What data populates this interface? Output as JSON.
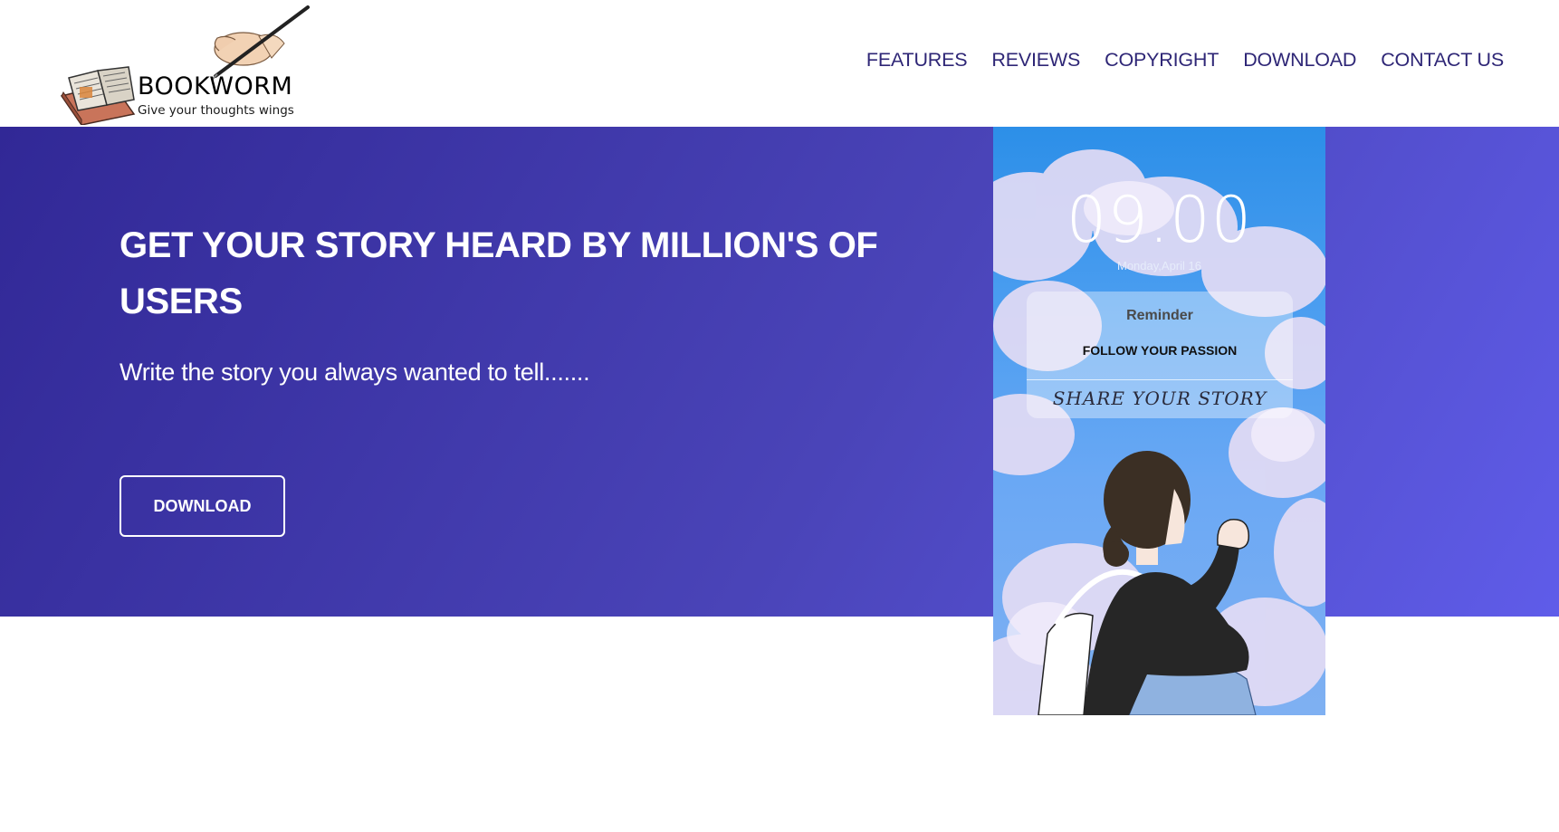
{
  "brand": {
    "name": "BOOKWORM",
    "tagline": "Give your thoughts wings"
  },
  "nav": {
    "items": [
      {
        "label": "FEATURES"
      },
      {
        "label": "REVIEWS"
      },
      {
        "label": "COPYRIGHT"
      },
      {
        "label": "DOWNLOAD"
      },
      {
        "label": "CONTACT US"
      }
    ]
  },
  "hero": {
    "title": "GET YOUR STORY HEARD BY MILLION'S OF USERS",
    "subtitle": "Write the story you always wanted to tell.......",
    "button_label": "DOWNLOAD"
  },
  "phone": {
    "time": "09.00",
    "date": "Monday,April 16",
    "reminder_title": "Reminder",
    "reminder_body": "FOLLOW YOUR PASSION",
    "reminder_note": "SHARE YOUR STORY"
  },
  "colors": {
    "nav_text": "#2e2676",
    "hero_gradient_start": "#312896",
    "hero_gradient_end": "#5f5ce9",
    "phone_sky": "#4a9df0"
  },
  "icons": {
    "logo": "book-and-quill-logo",
    "phone_art": "girl-looking-at-sky-illustration"
  }
}
